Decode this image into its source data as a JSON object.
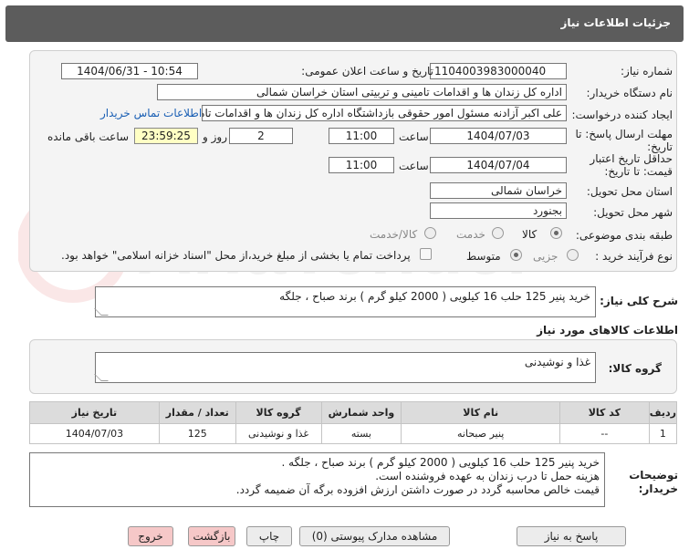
{
  "header": {
    "title": "جزئیات اطلاعات نیاز"
  },
  "form": {
    "need_number_label": "شماره نیاز:",
    "need_number": "1104003983000040",
    "announce_label": "تاریخ و ساعت اعلان عمومی:",
    "announce_value": "1404/06/31 - 10:54",
    "buyer_org_label": "نام دستگاه خریدار:",
    "buyer_org": "اداره کل زندان ها و اقدامات تامینی و تربیتی استان خراسان شمالی",
    "creator_label": "ایجاد کننده درخواست:",
    "creator": "علی اکبر  آزادنه مسئول امور حقوقی بازداشتگاه اداره کل زندان ها و اقدامات تامی",
    "contact_link": "اطلاعات تماس خریدار",
    "deadline_label": "مهلت ارسال پاسخ: تا تاریخ:",
    "deadline_date": "1404/07/03",
    "time_label": "ساعت",
    "deadline_time": "11:00",
    "days_value": "2",
    "days_label": "روز و",
    "remaining_time": "23:59:25",
    "remaining_label": "ساعت باقی مانده",
    "min_price_label": "حداقل تاریخ اعتبار قیمت: تا تاریخ:",
    "min_price_date": "1404/07/04",
    "min_price_time": "11:00",
    "province_label": "استان محل تحویل:",
    "province": "خراسان شمالی",
    "city_label": "شهر محل تحویل:",
    "city": "بجنورد",
    "category_label": "طبقه بندی موضوعی:",
    "category_options": [
      "کالا",
      "خدمت",
      "کالا/خدمت"
    ],
    "process_label": "نوع فرآیند خرید :",
    "process_options": [
      "جزیی",
      "متوسط"
    ],
    "payment_note": "پرداخت تمام یا بخشی از مبلغ خرید،از محل \"اسناد خزانه اسلامی\" خواهد بود."
  },
  "summary": {
    "label": "شرح کلی نیاز:",
    "text": "خرید پنیر 125 حلب 16 کیلویی ( 2000 کیلو گرم ) برند صباح ، جلگه"
  },
  "goods": {
    "section_title": "اطلاعات کالاهای مورد نیاز",
    "group_label": "گروه کالا:",
    "group_value": "غذا و نوشیدنی"
  },
  "table": {
    "headers": [
      "ردیف",
      "کد کالا",
      "نام کالا",
      "واحد شمارش",
      "گروه کالا",
      "تعداد / مقدار",
      "تاریخ نیاز"
    ],
    "rows": [
      [
        "1",
        "--",
        "پنیر صبحانه",
        "بسته",
        "غذا و نوشیدنی",
        "125",
        "1404/07/03"
      ]
    ]
  },
  "notes": {
    "label": "توضیحات خریدار:",
    "lines": [
      "خرید پنیر 125 حلب 16 کیلویی ( 2000 کیلو گرم ) برند صباح ، جلگه .",
      "هزینه حمل تا درب زندان به عهده فروشنده است.",
      "قیمت خالص محاسبه گردد در صورت داشتن ارزش افزوده برگه آن ضمیمه گردد."
    ]
  },
  "buttons": {
    "reply": "پاسخ به نیاز",
    "view_docs": "مشاهده مدارک پیوستی (0)",
    "print": "چاپ",
    "back": "بازگشت",
    "exit": "خروج"
  },
  "watermark": "AriaTender.neT"
}
